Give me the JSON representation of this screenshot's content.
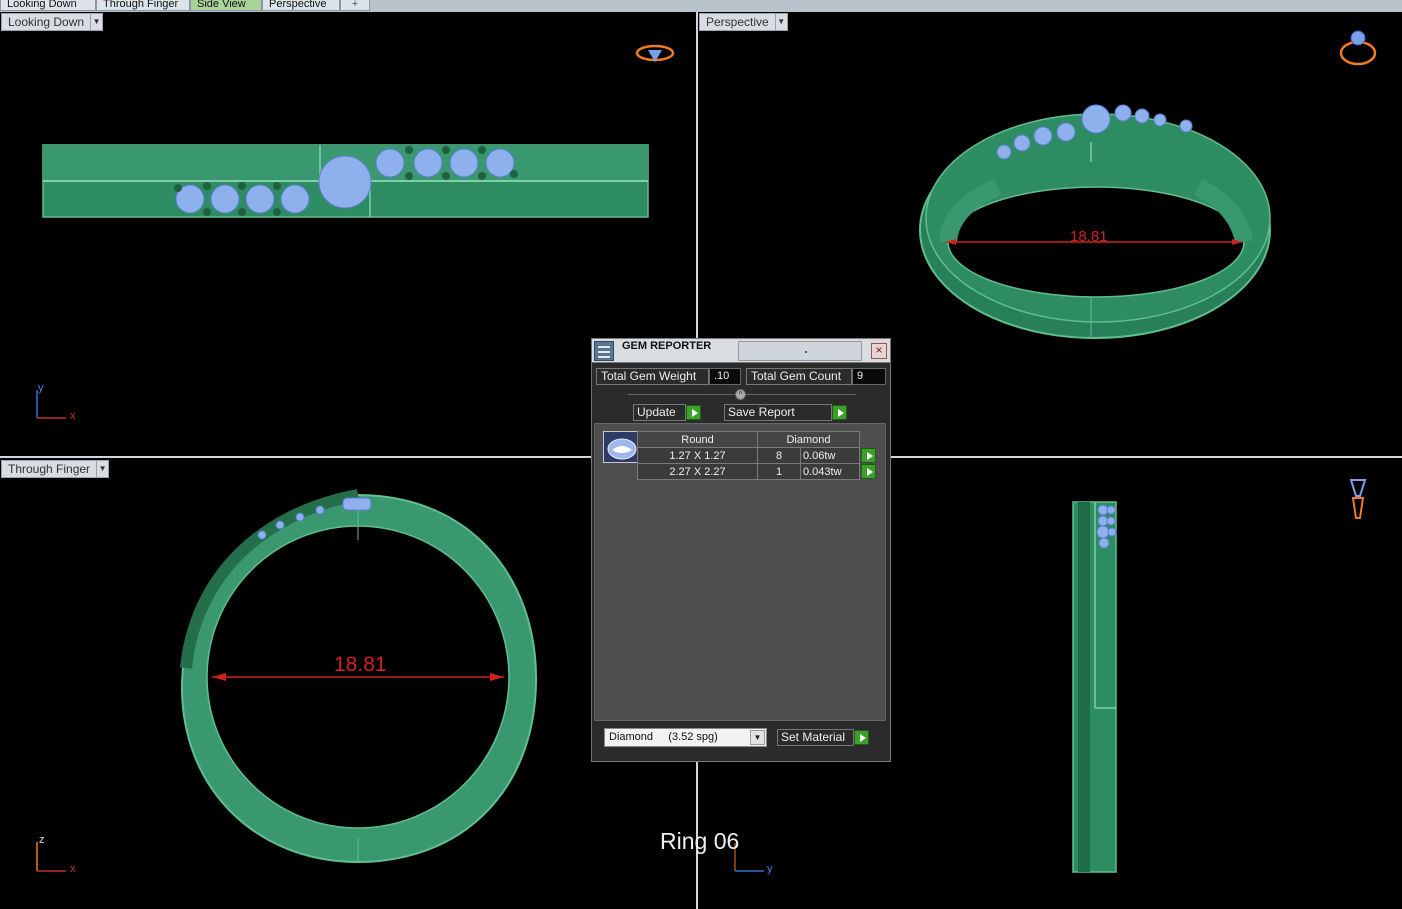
{
  "tabs": [
    {
      "label": "Looking Down"
    },
    {
      "label": "Through Finger"
    },
    {
      "label": "Side View"
    },
    {
      "label": "Perspective"
    },
    {
      "label": "+"
    }
  ],
  "viewports": {
    "top_left": {
      "label": "Looking Down",
      "axis_v": "y",
      "axis_h": "x"
    },
    "top_right": {
      "label": "Perspective",
      "dimension": "18.81"
    },
    "bottom_left": {
      "label": "Through Finger",
      "axis_v": "z",
      "axis_h": "x",
      "dimension": "18.81"
    },
    "bottom_right": {
      "axis_h": "y"
    }
  },
  "ring_label": "Ring 06",
  "gem_reporter": {
    "title": "GEM REPORTER",
    "total_weight_label": "Total Gem Weight",
    "total_weight_value": ".10",
    "total_count_label": "Total Gem Count",
    "total_count_value": "9",
    "update_label": "Update",
    "save_report_label": "Save Report",
    "table": {
      "headers": [
        "Round",
        "Diamond"
      ],
      "rows": [
        {
          "size": "1.27 X 1.27",
          "count": "8",
          "weight": "0.06tw"
        },
        {
          "size": "2.27 X 2.27",
          "count": "1",
          "weight": "0.043tw"
        }
      ]
    },
    "material_value": "Diamond     (3.52 spg)",
    "set_material_label": "Set Material"
  },
  "colors": {
    "metal": "#2e8c62",
    "metal_dark": "#1f6b4a",
    "gem": "#8eb0ec",
    "dimension": "#d02020",
    "go_button": "#3ea02c"
  }
}
